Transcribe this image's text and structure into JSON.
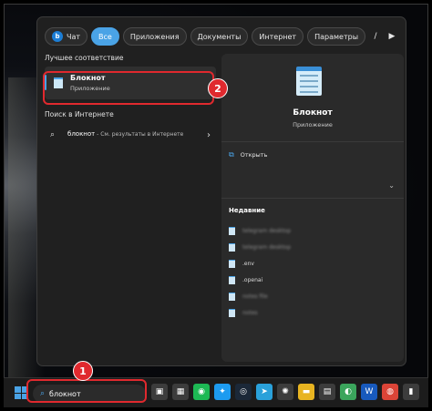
{
  "filters": {
    "chat_label": "Чат",
    "all_label": "Все",
    "apps_label": "Приложения",
    "docs_label": "Документы",
    "internet_label": "Интернет",
    "settings_label": "Параметры",
    "letter_cut": "/",
    "avatar_letter": "S"
  },
  "results": {
    "best_match_title": "Лучшее соответствие",
    "best_name": "Блокнот",
    "best_type": "Приложение",
    "web_title": "Поиск в Интернете",
    "web_query": "блокнот",
    "web_sub": " - См. результаты в Интернете"
  },
  "preview": {
    "app_name": "Блокнот",
    "app_type": "Приложение",
    "open_label": "Открыть",
    "recent_title": "Недавние",
    "recent_items": [
      {
        "name": "telegram desktop",
        "blurred": true
      },
      {
        "name": "telegram desktop",
        "blurred": true
      },
      {
        "name": ".env",
        "blurred": false
      },
      {
        "name": ".openai",
        "blurred": false
      },
      {
        "name": "notes file",
        "blurred": true
      },
      {
        "name": "notes",
        "blurred": true
      }
    ]
  },
  "annotations": {
    "step1": "1",
    "step2": "2"
  },
  "taskbar": {
    "search_value": "блокнот",
    "icons": [
      {
        "name": "task-view-icon",
        "glyph": "▣",
        "color": "#3c3c3c"
      },
      {
        "name": "calculator-icon",
        "glyph": "▦",
        "color": "#3c3c3c"
      },
      {
        "name": "spotify-icon",
        "glyph": "◉",
        "color": "#1db954"
      },
      {
        "name": "twitter-icon",
        "glyph": "✦",
        "color": "#1d9bf0"
      },
      {
        "name": "steam-icon",
        "glyph": "◎",
        "color": "#1b2838"
      },
      {
        "name": "telegram-icon",
        "glyph": "➤",
        "color": "#2aa1da"
      },
      {
        "name": "chatgpt-icon",
        "glyph": "✺",
        "color": "#3c3c3c"
      },
      {
        "name": "explorer-icon",
        "glyph": "▬",
        "color": "#e8b421"
      },
      {
        "name": "store-icon",
        "glyph": "▤",
        "color": "#3c3c3c"
      },
      {
        "name": "browser-icon",
        "glyph": "◐",
        "color": "#3ba55c"
      },
      {
        "name": "word-icon",
        "glyph": "W",
        "color": "#185abd"
      },
      {
        "name": "chrome-icon",
        "glyph": "◍",
        "color": "#db4437"
      },
      {
        "name": "terminal-icon",
        "glyph": "▮",
        "color": "#3c3c3c"
      }
    ]
  }
}
